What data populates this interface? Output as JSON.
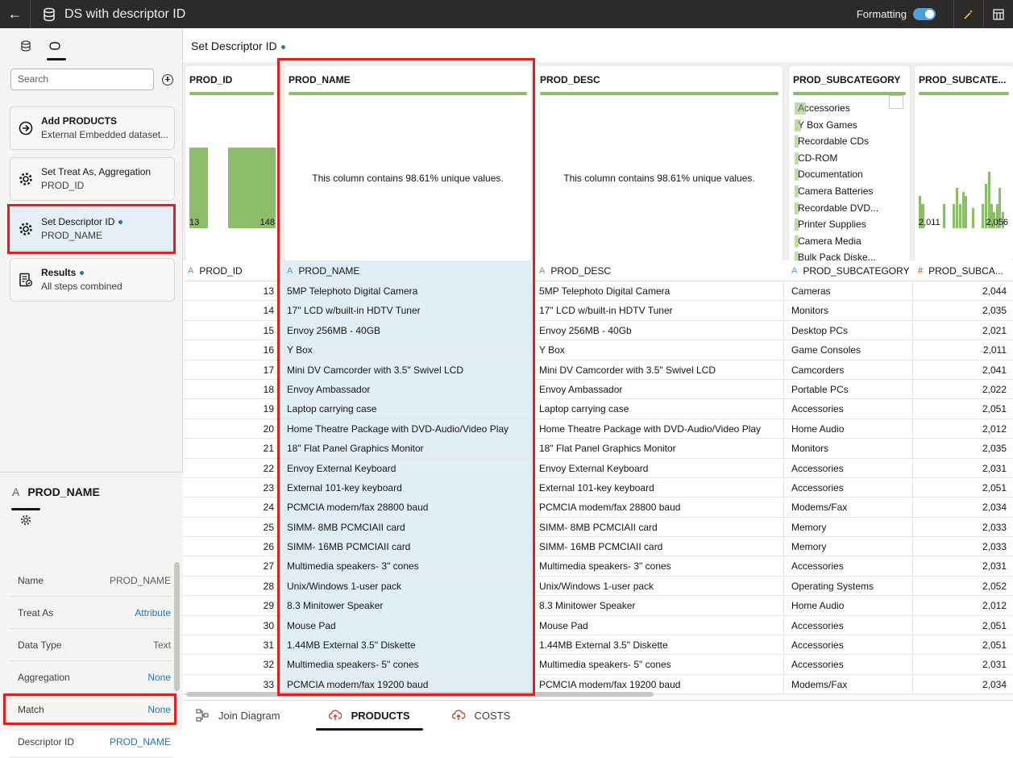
{
  "topbar": {
    "title": "DS with descriptor ID",
    "formatting_label": "Formatting"
  },
  "left_panel": {
    "search_placeholder": "Search",
    "steps": [
      {
        "title": "Add PRODUCTS",
        "subtitle": "External Embedded dataset..."
      },
      {
        "title": "Set Treat As, Aggregation",
        "subtitle": "PROD_ID"
      },
      {
        "title": "Set Descriptor ID",
        "subtitle": "PROD_NAME"
      },
      {
        "title": "Results",
        "subtitle": "All steps combined"
      }
    ],
    "properties": {
      "type_glyph": "A",
      "column": "PROD_NAME",
      "rows": [
        {
          "key": "Name",
          "value": "PROD_NAME"
        },
        {
          "key": "Treat As",
          "value": "Attribute"
        },
        {
          "key": "Data Type",
          "value": "Text"
        },
        {
          "key": "Aggregation",
          "value": "None"
        },
        {
          "key": "Match",
          "value": "None"
        },
        {
          "key": "Descriptor ID",
          "value": "PROD_NAME"
        }
      ]
    }
  },
  "main": {
    "title": "Set Descriptor ID",
    "profiles": {
      "prod_id": {
        "title": "PROD_ID",
        "min": "13",
        "max": "148"
      },
      "prod_name": {
        "title": "PROD_NAME",
        "message": "This column contains 98.61% unique values."
      },
      "prod_desc": {
        "title": "PROD_DESC",
        "message": "This column contains 98.61% unique values."
      },
      "prod_subcategory": {
        "title": "PROD_SUBCATEGORY",
        "categories": [
          "Accessories",
          "Y Box Games",
          "Recordable CDs",
          "CD-ROM",
          "Documentation",
          "Camera Batteries",
          "Recordable DVD...",
          "Printer Supplies",
          "Camera Media",
          "Bulk Pack Diske..."
        ]
      },
      "prod_subcat_id": {
        "title": "PROD_SUBCATE...",
        "min": "2,011",
        "max": "2,056"
      }
    },
    "columns": [
      {
        "type": "A",
        "label": "PROD_ID"
      },
      {
        "type": "A",
        "label": "PROD_NAME"
      },
      {
        "type": "A",
        "label": "PROD_DESC"
      },
      {
        "type": "A",
        "label": "PROD_SUBCATEGORY"
      },
      {
        "type": "#",
        "label": "PROD_SUBCA..."
      }
    ],
    "rows": [
      [
        "13",
        "5MP Telephoto Digital Camera",
        "5MP Telephoto Digital Camera",
        "Cameras",
        "2,044"
      ],
      [
        "14",
        "17\" LCD w/built-in HDTV Tuner",
        "17\" LCD w/built-in HDTV Tuner",
        "Monitors",
        "2,035"
      ],
      [
        "15",
        "Envoy 256MB - 40GB",
        "Envoy 256MB - 40Gb",
        "Desktop PCs",
        "2,021"
      ],
      [
        "16",
        "Y Box",
        "Y Box",
        "Game Consoles",
        "2,011"
      ],
      [
        "17",
        "Mini DV Camcorder with 3.5\" Swivel LCD",
        "Mini DV Camcorder with 3.5\" Swivel LCD",
        "Camcorders",
        "2,041"
      ],
      [
        "18",
        "Envoy Ambassador",
        "Envoy Ambassador",
        "Portable PCs",
        "2,022"
      ],
      [
        "19",
        "Laptop carrying case",
        "Laptop carrying case",
        "Accessories",
        "2,051"
      ],
      [
        "20",
        "Home Theatre Package with DVD-Audio/Video Play",
        "Home Theatre Package with DVD-Audio/Video Play",
        "Home Audio",
        "2,012"
      ],
      [
        "21",
        "18\" Flat Panel Graphics Monitor",
        "18\" Flat Panel Graphics Monitor",
        "Monitors",
        "2,035"
      ],
      [
        "22",
        "Envoy External Keyboard",
        "Envoy External Keyboard",
        "Accessories",
        "2,031"
      ],
      [
        "23",
        "External 101-key keyboard",
        "External 101-key keyboard",
        "Accessories",
        "2,051"
      ],
      [
        "24",
        "PCMCIA modem/fax 28800 baud",
        "PCMCIA modem/fax 28800 baud",
        "Modems/Fax",
        "2,034"
      ],
      [
        "25",
        "SIMM- 8MB PCMCIAII card",
        "SIMM- 8MB PCMCIAII card",
        "Memory",
        "2,033"
      ],
      [
        "26",
        "SIMM- 16MB PCMCIAII card",
        "SIMM- 16MB PCMCIAII card",
        "Memory",
        "2,033"
      ],
      [
        "27",
        "Multimedia speakers- 3\" cones",
        "Multimedia speakers- 3\" cones",
        "Accessories",
        "2,031"
      ],
      [
        "28",
        "Unix/Windows 1-user pack",
        "Unix/Windows 1-user pack",
        "Operating Systems",
        "2,052"
      ],
      [
        "29",
        "8.3 Minitower Speaker",
        "8.3 Minitower Speaker",
        "Home Audio",
        "2,012"
      ],
      [
        "30",
        "Mouse Pad",
        "Mouse Pad",
        "Accessories",
        "2,051"
      ],
      [
        "31",
        "1.44MB External 3.5\" Diskette",
        "1.44MB External 3.5\" Diskette",
        "Accessories",
        "2,051"
      ],
      [
        "32",
        "Multimedia speakers- 5\" cones",
        "Multimedia speakers- 5\" cones",
        "Accessories",
        "2,031"
      ],
      [
        "33",
        "PCMCIA modem/fax 19200 baud",
        "PCMCIA modem/fax 19200 baud",
        "Modems/Fax",
        "2,034"
      ]
    ],
    "bottom_tabs": [
      {
        "label": "Join Diagram"
      },
      {
        "label": "PRODUCTS"
      },
      {
        "label": "COSTS"
      }
    ]
  },
  "colors": {
    "accent": "#2376b4",
    "highlight": "#e02020",
    "bar": "#8bbd6b",
    "selected_column": "#e1eef5"
  }
}
